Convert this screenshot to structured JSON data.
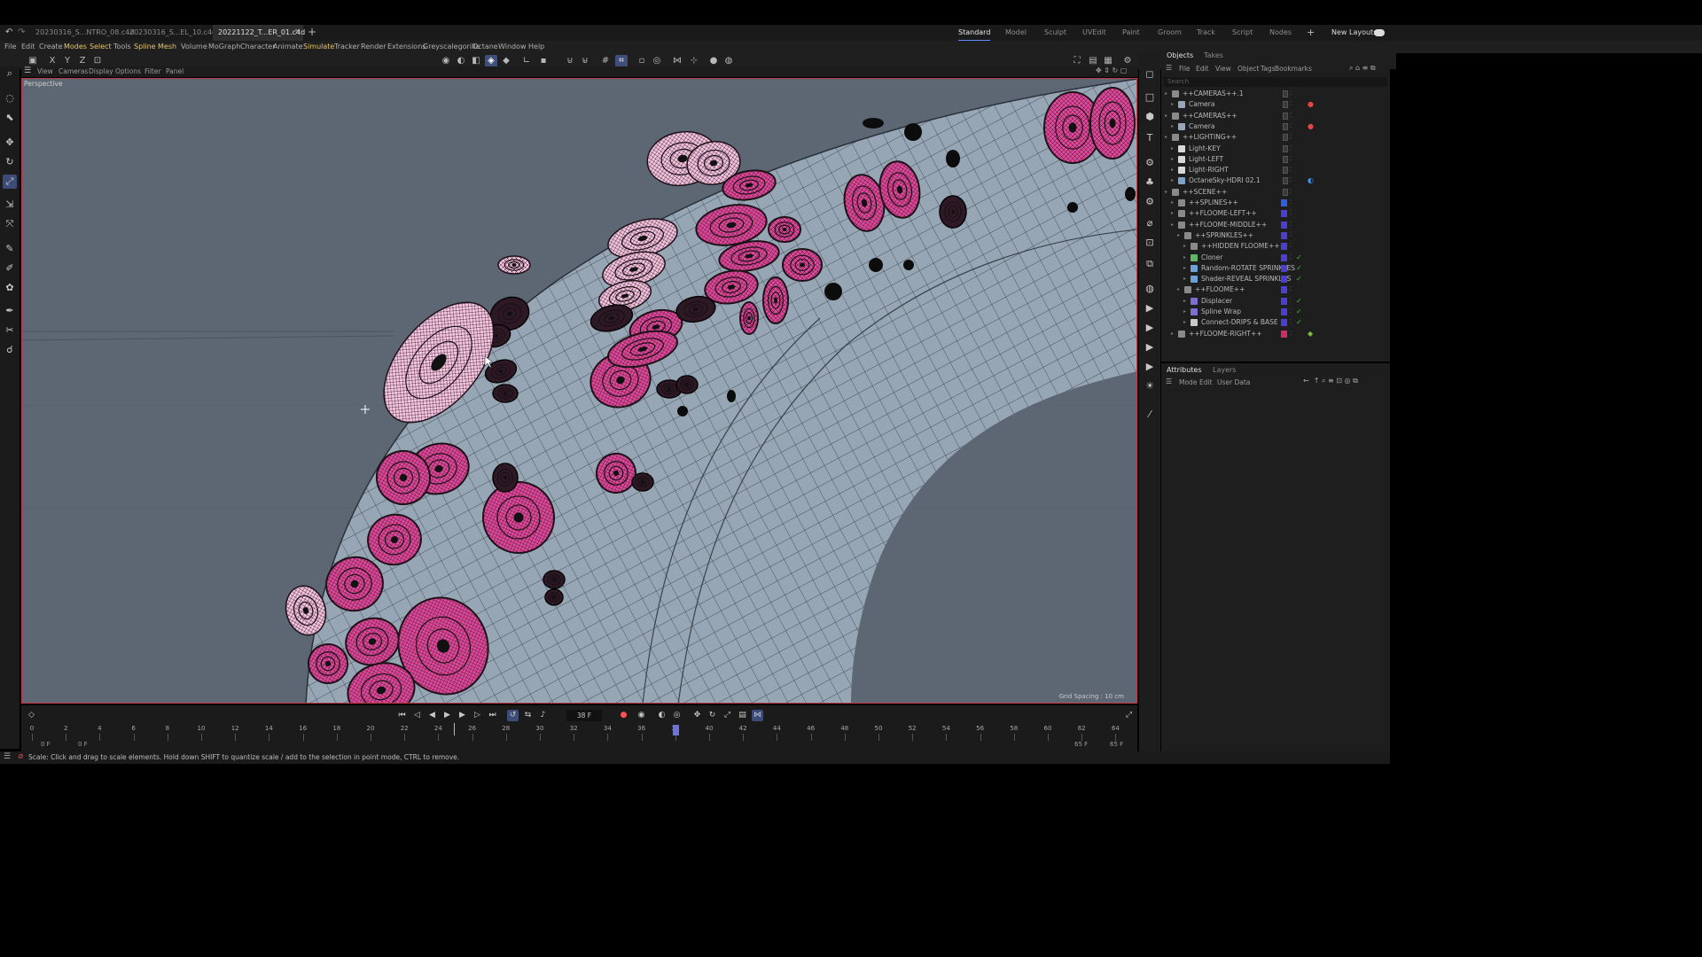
{
  "file_tabs": [
    "20230316_S...NTRO_08.c4d",
    "20230316_S...EL_10.c4d *",
    "20221122_T...ER_01.c4d *"
  ],
  "layouts": [
    "Standard",
    "Model",
    "Sculpt",
    "UVEdit",
    "Paint",
    "Groom",
    "Track",
    "Script",
    "Nodes"
  ],
  "new_layouts_label": "New Layouts",
  "menu": [
    "File",
    "Edit",
    "Create",
    "Modes",
    "Select",
    "Tools",
    "Spline",
    "Mesh",
    "Volume",
    "MoGraph",
    "Character",
    "Animate",
    "Simulate",
    "Tracker",
    "Render",
    "Extensions",
    "Greyscalegorilla",
    "Octane",
    "Window",
    "Help"
  ],
  "axis_buttons": [
    "X",
    "Y",
    "Z"
  ],
  "viewport_menu": [
    "View",
    "Cameras",
    "Display",
    "Options",
    "Filter",
    "Panel"
  ],
  "viewport_label": "Perspective",
  "grid_spacing": "Grid Spacing : 10 cm",
  "object_manager": {
    "tabs": [
      "Objects",
      "Takes"
    ],
    "menu": [
      "File",
      "Edit",
      "View",
      "Object",
      "Tags",
      "Bookmarks"
    ],
    "search_placeholder": "Search",
    "objects": [
      {
        "name": "++CAMERAS++.1",
        "depth": 0,
        "color": "",
        "check": false,
        "icon": "null-icon"
      },
      {
        "name": "Camera",
        "depth": 1,
        "color": "",
        "check": false,
        "icon": "camera-icon",
        "extra": "record-tag-icon"
      },
      {
        "name": "++CAMERAS++",
        "depth": 0,
        "color": "",
        "check": false,
        "icon": "null-icon"
      },
      {
        "name": "Camera",
        "depth": 1,
        "color": "",
        "check": false,
        "icon": "camera-icon",
        "extra": "record-tag-icon"
      },
      {
        "name": "++LIGHTING++",
        "depth": 0,
        "color": "",
        "check": false,
        "icon": "null-icon"
      },
      {
        "name": "Light-KEY",
        "depth": 1,
        "color": "",
        "check": false,
        "icon": "light-icon"
      },
      {
        "name": "Light-LEFT",
        "depth": 1,
        "color": "",
        "check": false,
        "icon": "light-icon"
      },
      {
        "name": "Light-RIGHT",
        "depth": 1,
        "color": "",
        "check": false,
        "icon": "light-icon"
      },
      {
        "name": "OctaneSky-HDRI 02.1",
        "depth": 1,
        "color": "",
        "check": false,
        "icon": "sky-icon",
        "extra": "octane-tag-icon"
      },
      {
        "name": "++SCENE++",
        "depth": 0,
        "color": "",
        "check": false,
        "icon": "null-icon"
      },
      {
        "name": "++SPLINES++",
        "depth": 1,
        "color": "#2f5fe0",
        "check": false,
        "icon": "null-icon"
      },
      {
        "name": "++FLOOME-LEFT++",
        "depth": 1,
        "color": "#4a3fd0",
        "check": false,
        "icon": "null-icon"
      },
      {
        "name": "++FLOOME-MIDDLE++",
        "depth": 1,
        "color": "#4a3fd0",
        "check": false,
        "icon": "null-icon"
      },
      {
        "name": "++SPRINKLES++",
        "depth": 2,
        "color": "#4a3fd0",
        "check": false,
        "icon": "null-icon"
      },
      {
        "name": "++HIDDEN FLOOME++",
        "depth": 3,
        "color": "#4a3fd0",
        "check": false,
        "icon": "null-icon"
      },
      {
        "name": "Cloner",
        "depth": 3,
        "color": "#4a3fd0",
        "check": true,
        "icon": "cloner-icon"
      },
      {
        "name": "Random-ROTATE SPRINKLES",
        "depth": 3,
        "color": "#4a3fd0",
        "check": true,
        "icon": "effector-icon"
      },
      {
        "name": "Shader-REVEAL SPRINKLES",
        "depth": 3,
        "color": "#4a3fd0",
        "check": true,
        "icon": "effector-icon"
      },
      {
        "name": "++FLOOME++",
        "depth": 2,
        "color": "#4a3fd0",
        "check": false,
        "icon": "null-icon"
      },
      {
        "name": "Displacer",
        "depth": 3,
        "color": "#4a3fd0",
        "check": true,
        "icon": "deformer-icon"
      },
      {
        "name": "Spline Wrap",
        "depth": 3,
        "color": "#4a3fd0",
        "check": true,
        "icon": "deformer-icon"
      },
      {
        "name": "Connect-DRIPS & BASE",
        "depth": 3,
        "color": "#4a3fd0",
        "check": true,
        "icon": "connect-icon"
      },
      {
        "name": "++FLOOME-RIGHT++",
        "depth": 1,
        "color": "#d02c6a",
        "check": false,
        "icon": "null-icon",
        "extra": "material-tag-icon"
      }
    ]
  },
  "attributes": {
    "tabs": [
      "Attributes",
      "Layers"
    ],
    "menu": [
      "Mode",
      "Edit",
      "User Data"
    ]
  },
  "timeline": {
    "current_frame": "38 F",
    "ruler_labels": [
      "0",
      "2",
      "4",
      "6",
      "8",
      "10",
      "12",
      "14",
      "16",
      "18",
      "20",
      "22",
      "24",
      "26",
      "28",
      "30",
      "32",
      "34",
      "36",
      "38",
      "40",
      "42",
      "44",
      "46",
      "48",
      "50",
      "52",
      "54",
      "56",
      "58",
      "60",
      "62",
      "64"
    ],
    "start_label": "0 F",
    "start_label2": "0 F",
    "end_label": "65 F",
    "end_label2": "65 F"
  },
  "status_text": "Scale: Click and drag to scale elements. Hold down SHIFT to quantize scale / add to the selection in point mode, CTRL to remove.",
  "colors": {
    "accent": "#5b8cff",
    "viewport_bg": "#5c6773",
    "viewport_border": "#c0394a",
    "sprinkle_pink": "#e0479a",
    "sprinkle_light": "#f2c4de"
  }
}
